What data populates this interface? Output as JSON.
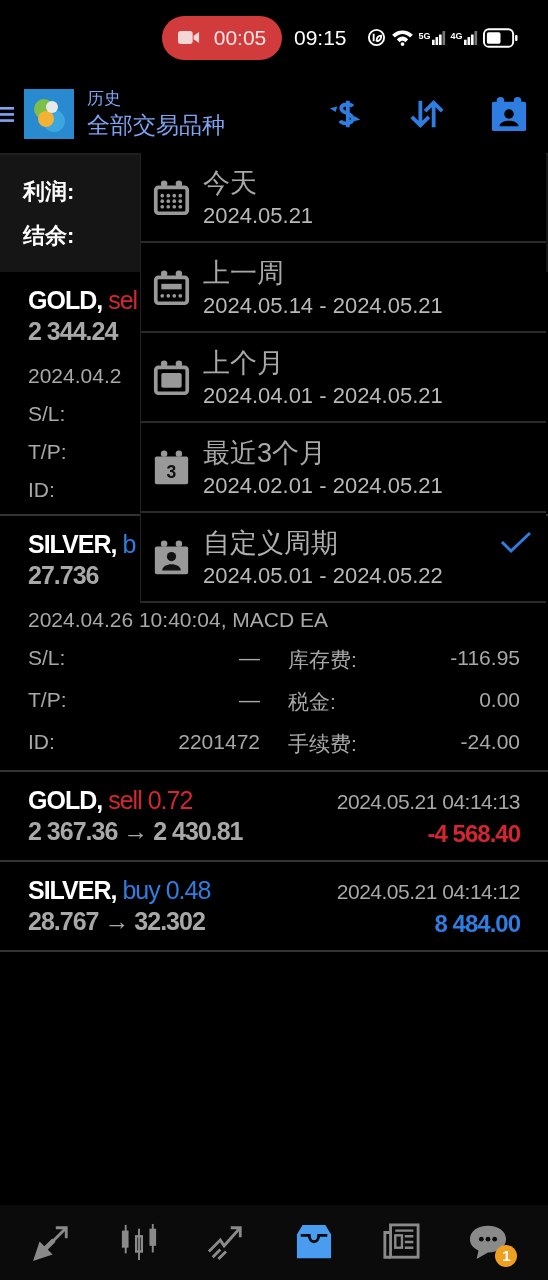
{
  "status_bar": {
    "recording": "00:05",
    "time": "09:15",
    "networks": [
      "5G",
      "4G"
    ]
  },
  "toolbar": {
    "subtitle": "历史",
    "title": "全部交易品种"
  },
  "summary": [
    {
      "label": "利润:"
    },
    {
      "label": "结余:"
    }
  ],
  "trades": [
    {
      "symbol": "GOLD,",
      "order": "sel",
      "kind": "sell",
      "prices": "2 344.24",
      "expanded": true,
      "comment": "2024.04.2",
      "fields": [
        {
          "label": "S/L:"
        },
        {
          "label": "T/P:"
        },
        {
          "label": "ID:"
        }
      ]
    },
    {
      "symbol": "SILVER,",
      "order": "b",
      "kind": "buy",
      "prices": "27.736",
      "expanded": true,
      "comment": "2024.04.26 10:40:04, MACD EA",
      "fields": [
        {
          "label": "S/L:",
          "value": "—",
          "fee_label": "库存费:",
          "fee_value": "-116.95"
        },
        {
          "label": "T/P:",
          "value": "—",
          "fee_label": "税金:",
          "fee_value": "0.00"
        },
        {
          "label": "ID:",
          "value": "2201472",
          "fee_label": "手续费:",
          "fee_value": "-24.00"
        }
      ]
    },
    {
      "symbol": "GOLD,",
      "order": "sell 0.72",
      "kind": "sell",
      "prices": "2 367.36 → 2 430.81",
      "time": "2024.05.21 04:14:13",
      "profit": "-4 568.40",
      "loss": true,
      "expanded": false
    },
    {
      "symbol": "SILVER,",
      "order": "buy 0.48",
      "kind": "buy",
      "prices": "28.767 → 32.302",
      "time": "2024.05.21 04:14:12",
      "profit": "8 484.00",
      "loss": false,
      "expanded": false
    }
  ],
  "period_menu": [
    {
      "kind": "grid",
      "title": "今天",
      "range": "2024.05.21",
      "selected": false
    },
    {
      "kind": "week",
      "title": "上一周",
      "range": "2024.05.14 - 2024.05.21",
      "selected": false
    },
    {
      "kind": "month",
      "title": "上个月",
      "range": "2024.04.01 - 2024.05.21",
      "selected": false
    },
    {
      "kind": "number",
      "icon_text": "3",
      "title": "最近3个月",
      "range": "2024.02.01 - 2024.05.21",
      "selected": false
    },
    {
      "kind": "person",
      "title": "自定义周期",
      "range": "2024.05.01 - 2024.05.22",
      "selected": true
    }
  ],
  "bottom_nav": [
    {
      "kind": "trade",
      "selected": false
    },
    {
      "kind": "chart",
      "selected": false
    },
    {
      "kind": "trend",
      "selected": false
    },
    {
      "kind": "history",
      "selected": true
    },
    {
      "kind": "news",
      "selected": false
    },
    {
      "kind": "chat",
      "selected": false,
      "badge": "1"
    }
  ]
}
